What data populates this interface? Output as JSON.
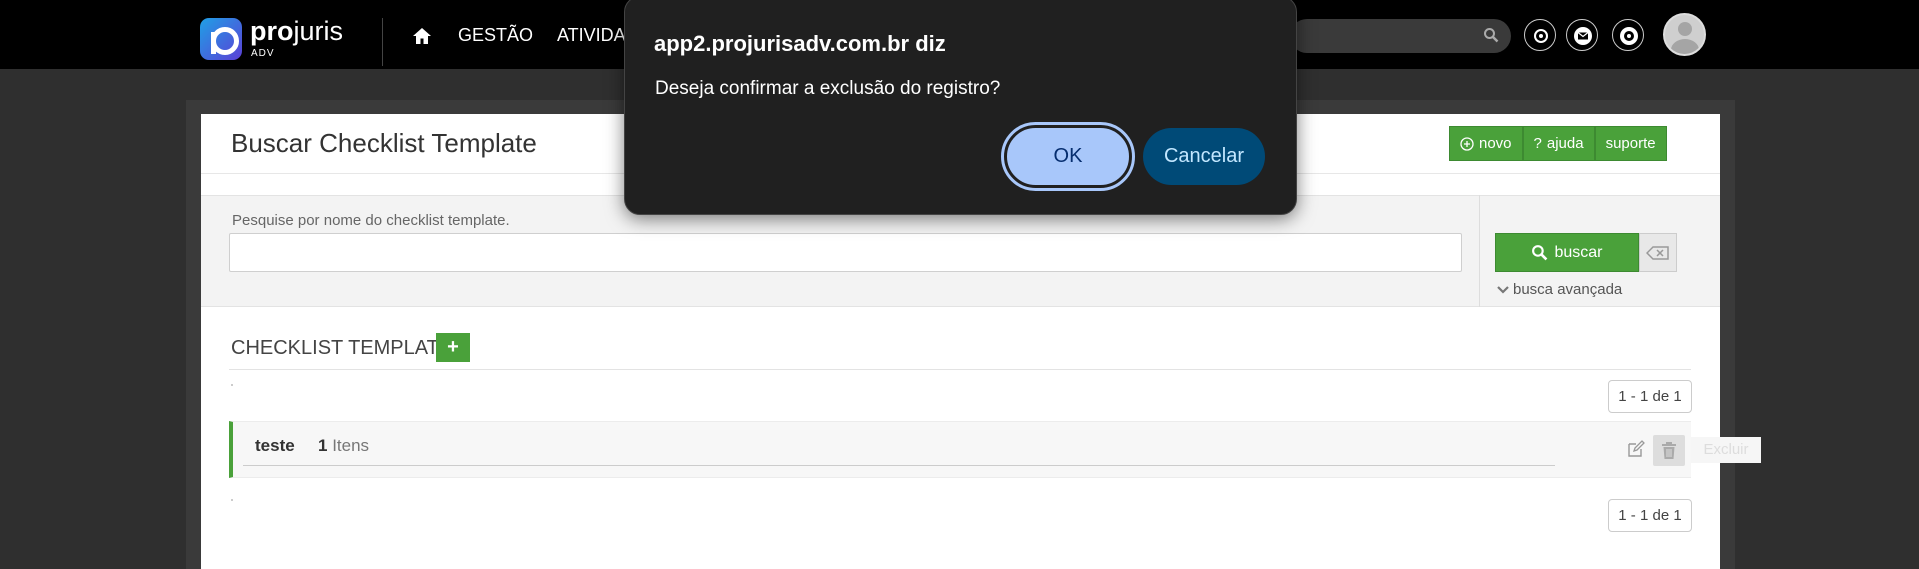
{
  "topbar": {
    "logo": {
      "name_bold": "pro",
      "name_light": "juris",
      "sub": "ADV"
    },
    "nav": [
      {
        "label": "GESTÃO"
      },
      {
        "label": "ATIVIDA"
      }
    ]
  },
  "page": {
    "title": "Buscar Checklist Template",
    "actions": {
      "novo": "novo",
      "ajuda": "ajuda",
      "suporte": "suporte"
    }
  },
  "search": {
    "label": "Pesquise por nome do checklist template.",
    "value": "",
    "button": "buscar",
    "advanced": "busca avançada"
  },
  "list": {
    "section_title": "CHECKLIST TEMPLATE",
    "add_symbol": "+",
    "pager_top": "1 - 1 de 1",
    "pager_bottom": "1 - 1 de 1",
    "items": [
      {
        "name": "teste",
        "count": "1",
        "count_label": "Itens"
      }
    ],
    "delete_tooltip": "Excluir"
  },
  "dialog": {
    "title": "app2.projurisadv.com.br diz",
    "message": "Deseja confirmar a exclusão do registro?",
    "ok": "OK",
    "cancel": "Cancelar"
  },
  "colors": {
    "accent_green": "#4aa13a",
    "dialog_ok_bg": "#a8c7fa",
    "dialog_cancel_bg": "#004a77"
  }
}
